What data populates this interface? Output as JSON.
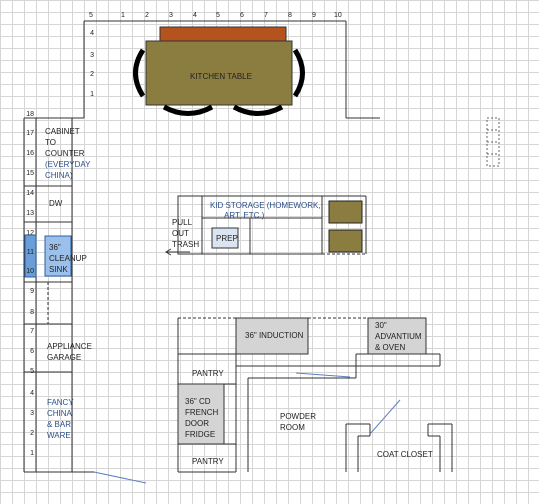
{
  "labels": {
    "kitchen_table": "KITCHEN TABLE",
    "cabinet": [
      "CABINET",
      "TO",
      "COUNTER",
      "(EVERYDAY",
      "CHINA)"
    ],
    "dw": "DW",
    "sink": [
      "36\"",
      "CLEANUP",
      "SINK"
    ],
    "appliance_garage": [
      "APPLIANCE",
      "GARAGE"
    ],
    "fancy_china": [
      "FANCY",
      "CHINA",
      "& BAR",
      "WARE"
    ],
    "kid_storage": "KID STORAGE  (HOMEWORK,",
    "kid_storage_2": "ART, ETC.)",
    "pull_out_trash": [
      "PULL",
      "OUT",
      "TRASH"
    ],
    "prep": "PREP",
    "induction": "36\" INDUCTION",
    "advantium": [
      "30\"",
      "ADVANTIUM",
      "& OVEN"
    ],
    "pantry_top": "PANTRY",
    "pantry_bottom": "PANTRY",
    "fridge": [
      "36\" CD",
      "FRENCH",
      "DOOR",
      "FRIDGE"
    ],
    "powder_room": [
      "POWDER",
      "ROOM"
    ],
    "coat_closet": "COAT CLOSET"
  },
  "axis_top": [
    "5",
    "1",
    "2",
    "3",
    "4",
    "5",
    "6",
    "7",
    "8",
    "9",
    "10"
  ],
  "axis_left_upper": [
    "4",
    "3",
    "2",
    "1"
  ],
  "axis_left_lower": [
    "18",
    "17",
    "16",
    "15",
    "14",
    "13",
    "12",
    "11",
    "10",
    "9",
    "8",
    "7",
    "6",
    "5",
    "4",
    "3",
    "2",
    "1"
  ],
  "colors": {
    "table": "#8b7d40",
    "table_top": "#b5531f",
    "sink": "#6a9ed8",
    "appliance": "#d4d4d4",
    "prep": "#dbe5f1",
    "storage_bin": "#8b7d40",
    "walls": "#333333",
    "door_lines": "#5b7fc0"
  }
}
